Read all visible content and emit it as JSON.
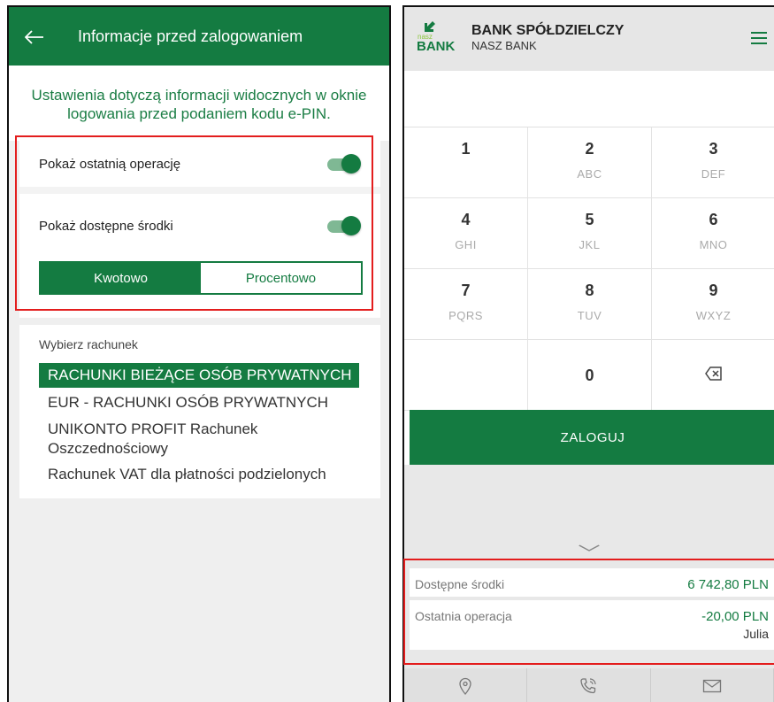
{
  "left_screen": {
    "header": {
      "back_icon": "arrow-left-icon",
      "title": "Informacje przed zalogowaniem"
    },
    "description": "Ustawienia dotyczą informacji widocznych w oknie logowania przed podaniem kodu e-PIN.",
    "options": [
      {
        "label": "Pokaż ostatnią operację",
        "enabled": true
      },
      {
        "label": "Pokaż dostępne środki",
        "enabled": true
      }
    ],
    "segment": {
      "selected": "Kwotowo",
      "other": "Procentowo"
    },
    "account_list_label": "Wybierz rachunek",
    "accounts": [
      "RACHUNKI BIEŻĄCE OSÓB PRYWATNYCH",
      "EUR - RACHUNKI OSÓB PRYWATNYCH",
      "UNIKONTO PROFIT Rachunek Oszczednościowy",
      "Rachunek VAT dla płatności podzielonych"
    ],
    "selected_account_index": 0
  },
  "right_screen": {
    "header": {
      "logo_small": "nasz",
      "logo_big": "BANK",
      "bank_name": "BANK SPÓŁDZIELCZY",
      "bank_sub": "NASZ BANK",
      "menu_icon": "hamburger-menu-icon"
    },
    "keypad": [
      {
        "digit": "1",
        "letters": ""
      },
      {
        "digit": "2",
        "letters": "ABC"
      },
      {
        "digit": "3",
        "letters": "DEF"
      },
      {
        "digit": "4",
        "letters": "GHI"
      },
      {
        "digit": "5",
        "letters": "JKL"
      },
      {
        "digit": "6",
        "letters": "MNO"
      },
      {
        "digit": "7",
        "letters": "PQRS"
      },
      {
        "digit": "8",
        "letters": "TUV"
      },
      {
        "digit": "9",
        "letters": "WXYZ"
      },
      {
        "digit": "0",
        "letters": ""
      }
    ],
    "backspace_icon": "backspace-icon",
    "login_label": "ZALOGUJ",
    "available_funds": {
      "label": "Dostępne środki",
      "value": "6 742,80 PLN"
    },
    "last_operation": {
      "label": "Ostatnia operacja",
      "value": "-20,00 PLN",
      "name": "Julia"
    },
    "bottom_icons": [
      "location-pin-icon",
      "phone-icon",
      "mail-icon"
    ]
  },
  "colors": {
    "brand_green": "#147b41",
    "highlight_red": "#e31d1d"
  }
}
